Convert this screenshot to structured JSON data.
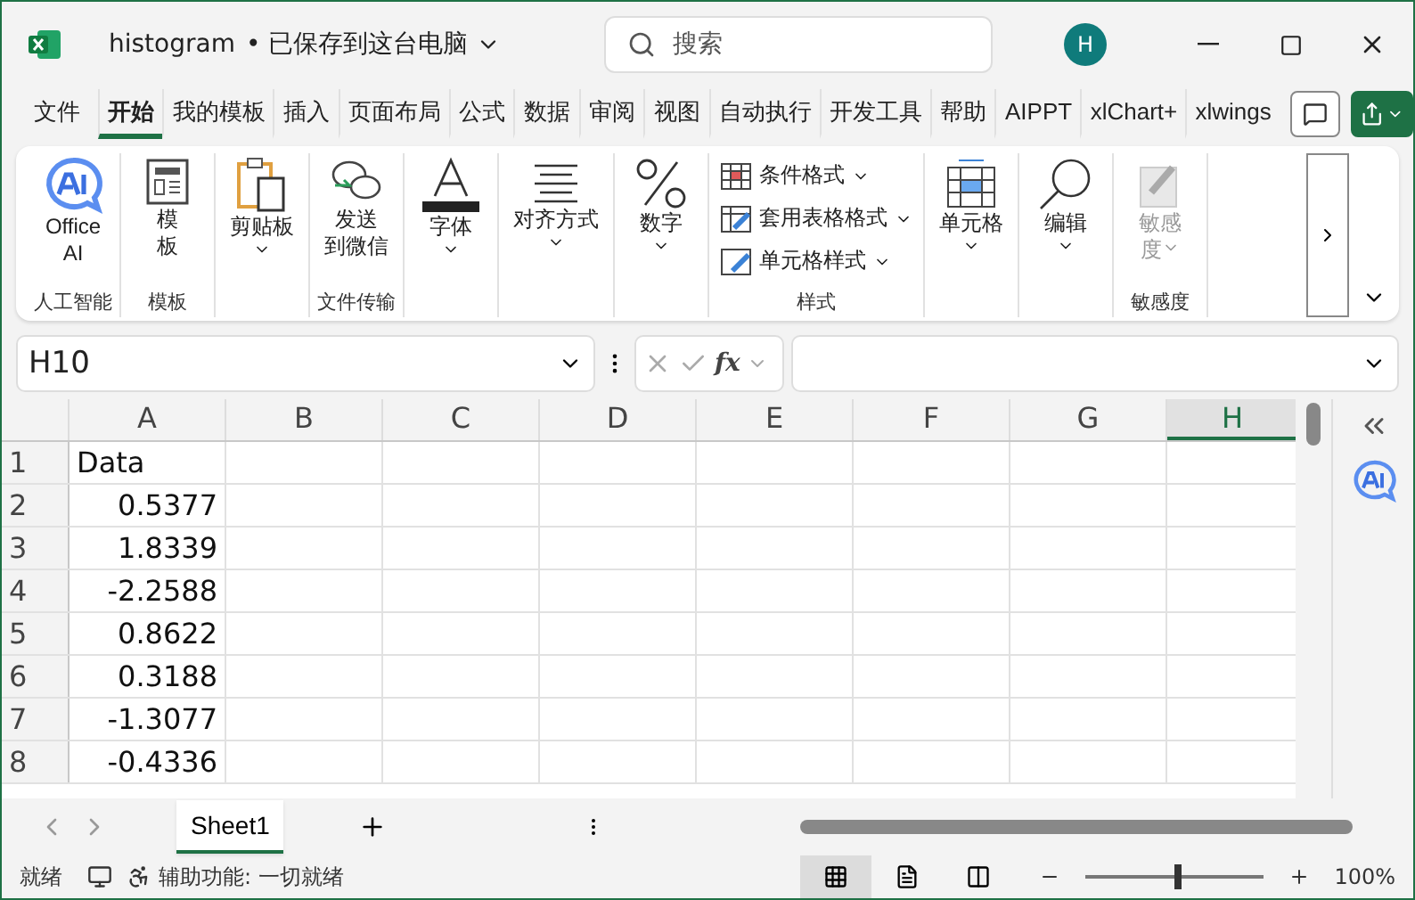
{
  "window": {
    "title": "histogram",
    "save_status": "• 已保存到这台电脑",
    "search_placeholder": "搜索",
    "avatar": "H"
  },
  "tabs": [
    {
      "label": "文件",
      "selected": false
    },
    {
      "label": "开始",
      "selected": true
    },
    {
      "label": "我的模板",
      "selected": false
    },
    {
      "label": "插入",
      "selected": false
    },
    {
      "label": "页面布局",
      "selected": false
    },
    {
      "label": "公式",
      "selected": false
    },
    {
      "label": "数据",
      "selected": false
    },
    {
      "label": "审阅",
      "selected": false
    },
    {
      "label": "视图",
      "selected": false
    },
    {
      "label": "自动执行",
      "selected": false
    },
    {
      "label": "开发工具",
      "selected": false
    },
    {
      "label": "帮助",
      "selected": false
    },
    {
      "label": "AIPPT",
      "selected": false
    },
    {
      "label": "xlChart+",
      "selected": false
    },
    {
      "label": "xlwings",
      "selected": false
    }
  ],
  "ribbon": [
    {
      "label": "人工智能",
      "items": [
        {
          "kind": "large",
          "lines": [
            "Office",
            "AI"
          ],
          "dropdown": false,
          "disabled": false
        }
      ]
    },
    {
      "label": "模板",
      "items": [
        {
          "kind": "large",
          "lines": [
            "模",
            "板"
          ],
          "dropdown": false,
          "disabled": false
        }
      ]
    },
    {
      "items": [
        {
          "kind": "large",
          "lines": [
            "剪贴板"
          ],
          "dropdown": true,
          "disabled": false
        }
      ]
    },
    {
      "label": "文件传输",
      "items": [
        {
          "kind": "large",
          "lines": [
            "发送",
            "到微信"
          ],
          "dropdown": false,
          "disabled": false
        }
      ]
    },
    {
      "items": [
        {
          "kind": "large",
          "lines": [
            "字体"
          ],
          "dropdown": true,
          "disabled": false
        }
      ]
    },
    {
      "items": [
        {
          "kind": "large",
          "lines": [
            "对齐方式"
          ],
          "dropdown": true,
          "disabled": false
        }
      ]
    },
    {
      "items": [
        {
          "kind": "large",
          "lines": [
            "数字"
          ],
          "dropdown": true,
          "disabled": false
        }
      ]
    },
    {
      "label": "样式",
      "items": [
        {
          "kind": "small",
          "lines": [
            "条件格式"
          ],
          "dropdown": true,
          "disabled": false
        },
        {
          "kind": "small",
          "lines": [
            "套用表格格式"
          ],
          "dropdown": true,
          "disabled": false
        },
        {
          "kind": "small",
          "lines": [
            "单元格样式"
          ],
          "dropdown": true,
          "disabled": false
        }
      ]
    },
    {
      "items": [
        {
          "kind": "large",
          "lines": [
            "单元格"
          ],
          "dropdown": true,
          "disabled": false
        }
      ]
    },
    {
      "items": [
        {
          "kind": "large",
          "lines": [
            "编辑"
          ],
          "dropdown": true,
          "disabled": false
        }
      ]
    },
    {
      "label": "敏感度",
      "items": [
        {
          "kind": "large",
          "lines": [
            "敏感",
            "度"
          ],
          "dropdown": true,
          "disabled": true
        }
      ]
    }
  ],
  "name_box": "H10",
  "function_label": "fx",
  "columns": [
    {
      "label": "A",
      "selected": false
    },
    {
      "label": "B",
      "selected": false
    },
    {
      "label": "C",
      "selected": false
    },
    {
      "label": "D",
      "selected": false
    },
    {
      "label": "E",
      "selected": false
    },
    {
      "label": "F",
      "selected": false
    },
    {
      "label": "G",
      "selected": false
    },
    {
      "label": "H",
      "selected": true
    }
  ],
  "rows": [
    {
      "number": "1",
      "cell": "Data",
      "kind": "text"
    },
    {
      "number": "2",
      "cell": "0.5377",
      "kind": "number"
    },
    {
      "number": "3",
      "cell": "1.8339",
      "kind": "number"
    },
    {
      "number": "4",
      "cell": "-2.2588",
      "kind": "number"
    },
    {
      "number": "5",
      "cell": "0.8622",
      "kind": "number"
    },
    {
      "number": "6",
      "cell": "0.3188",
      "kind": "number"
    },
    {
      "number": "7",
      "cell": "-1.3077",
      "kind": "number"
    },
    {
      "number": "8",
      "cell": "-0.4336",
      "kind": "number"
    }
  ],
  "sheets": [
    {
      "label": "Sheet1",
      "selected": true
    }
  ],
  "status_bar": {
    "mode": "就绪",
    "accessibility": "辅助功能: 一切就绪",
    "views": [
      {
        "kind": "normal",
        "selected": true
      },
      {
        "kind": "page_layout",
        "selected": false
      },
      {
        "kind": "page_break",
        "selected": false
      }
    ],
    "zoom": {
      "level": 0.5,
      "reading": "100%"
    }
  }
}
